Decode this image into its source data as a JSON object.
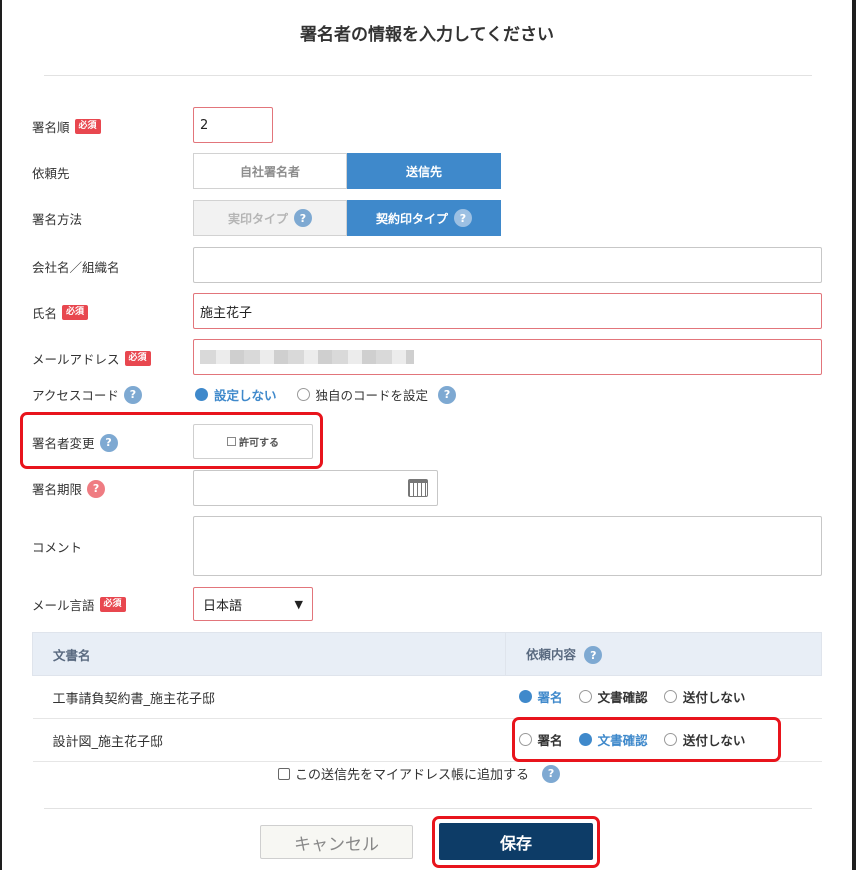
{
  "title": "署名者の情報を入力してください",
  "required_badge": "必須",
  "fields": {
    "sign_order": {
      "label": "署名順",
      "value": "2"
    },
    "request_to": {
      "label": "依頼先",
      "options": [
        "自社署名者",
        "送信先"
      ],
      "selected": "送信先"
    },
    "sign_method": {
      "label": "署名方法",
      "options": [
        "実印タイプ",
        "契約印タイプ"
      ],
      "selected": "契約印タイプ"
    },
    "company": {
      "label": "会社名／組織名",
      "value": ""
    },
    "name": {
      "label": "氏名",
      "value": "施主花子"
    },
    "email": {
      "label": "メールアドレス",
      "value": ""
    },
    "access_code": {
      "label": "アクセスコード",
      "options": [
        "設定しない",
        "独自のコードを設定"
      ],
      "selected": "設定しない"
    },
    "signer_change": {
      "label": "署名者変更",
      "checkbox_label": "許可する",
      "checked": false
    },
    "deadline": {
      "label": "署名期限",
      "value": ""
    },
    "comment": {
      "label": "コメント",
      "value": ""
    },
    "mail_lang": {
      "label": "メール言語",
      "value": "日本語"
    }
  },
  "docs_table": {
    "headers": [
      "文書名",
      "依頼内容"
    ],
    "rows": [
      {
        "name": "工事請負契約書_施主花子邸",
        "options": [
          "署名",
          "文書確認",
          "送付しない"
        ],
        "selected": "署名"
      },
      {
        "name": "設計図_施主花子邸",
        "options": [
          "署名",
          "文書確認",
          "送付しない"
        ],
        "selected": "文書確認"
      }
    ]
  },
  "address_book": {
    "label": "この送信先をマイアドレス帳に追加する",
    "checked": false
  },
  "buttons": {
    "cancel": "キャンセル",
    "save": "保存"
  },
  "colors": {
    "accent": "#3f89cb",
    "required": "#e8474f",
    "highlight": "#e8141c",
    "save": "#0d3c67"
  }
}
